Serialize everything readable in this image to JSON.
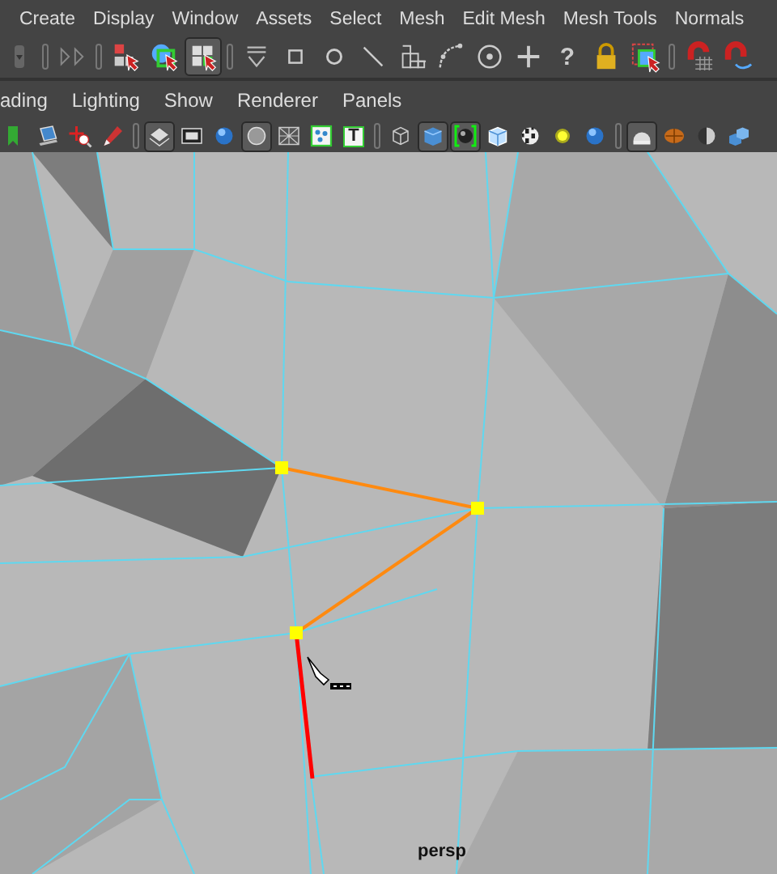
{
  "menu_bar": {
    "items": [
      "Create",
      "Display",
      "Window",
      "Assets",
      "Select",
      "Mesh",
      "Edit Mesh",
      "Mesh Tools",
      "Normals"
    ]
  },
  "status_toolbar": {
    "groups": [
      {
        "tools": [
          {
            "kind": "dropdown",
            "on": false
          }
        ]
      },
      {
        "tools": [
          {
            "kind": "collapse",
            "on": false
          }
        ]
      },
      {
        "tools": [
          {
            "kind": "hierarchy-select",
            "on": false
          },
          {
            "kind": "object-select",
            "on": false
          },
          {
            "kind": "component-select",
            "on": true
          }
        ]
      },
      {
        "tools": [
          {
            "kind": "stack",
            "on": false
          },
          {
            "kind": "square",
            "on": false
          },
          {
            "kind": "circle",
            "on": false
          },
          {
            "kind": "line",
            "on": false
          },
          {
            "kind": "blocks",
            "on": false
          },
          {
            "kind": "curve",
            "on": false
          },
          {
            "kind": "target",
            "on": false
          },
          {
            "kind": "plus",
            "on": false
          },
          {
            "kind": "glyph",
            "glyph": "?",
            "on": false
          },
          {
            "kind": "lock",
            "on": false
          },
          {
            "kind": "marquee-select",
            "on": false
          }
        ]
      },
      {
        "tools": [
          {
            "kind": "magnet-grid",
            "on": false
          },
          {
            "kind": "magnet-curve",
            "on": false
          }
        ]
      }
    ]
  },
  "panel_menu": {
    "items": [
      "ading",
      "Lighting",
      "Show",
      "Renderer",
      "Panels"
    ]
  },
  "panel_toolbar": {
    "groups": [
      {
        "tools": [
          {
            "kind": "bookmark",
            "on": false
          },
          {
            "kind": "laptop",
            "on": false
          },
          {
            "kind": "move-zoom",
            "on": false
          },
          {
            "kind": "pencil",
            "on": false
          }
        ]
      },
      {
        "tools": [
          {
            "kind": "layers",
            "on": true
          },
          {
            "kind": "film",
            "on": false
          },
          {
            "kind": "shaded-sphere",
            "on": false
          },
          {
            "kind": "flat-disc",
            "on": true
          },
          {
            "kind": "cross-grid",
            "on": false
          },
          {
            "kind": "dots",
            "on": false
          },
          {
            "kind": "glyph",
            "glyph": "T",
            "on": false
          }
        ]
      },
      {
        "tools": [
          {
            "kind": "wire-cube",
            "on": false
          },
          {
            "kind": "solid-cube",
            "on": true
          },
          {
            "kind": "bracket-ball",
            "on": true
          },
          {
            "kind": "light-cube",
            "on": false
          },
          {
            "kind": "checker-ball",
            "on": false
          },
          {
            "kind": "light-glow",
            "on": false
          },
          {
            "kind": "shaded-sphere",
            "on": false
          }
        ]
      },
      {
        "tools": [
          {
            "kind": "dome",
            "on": true
          },
          {
            "kind": "textured-ball",
            "on": false
          },
          {
            "kind": "half-sphere",
            "on": false
          },
          {
            "kind": "cube-pair",
            "on": false
          }
        ]
      }
    ]
  },
  "viewport": {
    "camera_label": "persp"
  }
}
